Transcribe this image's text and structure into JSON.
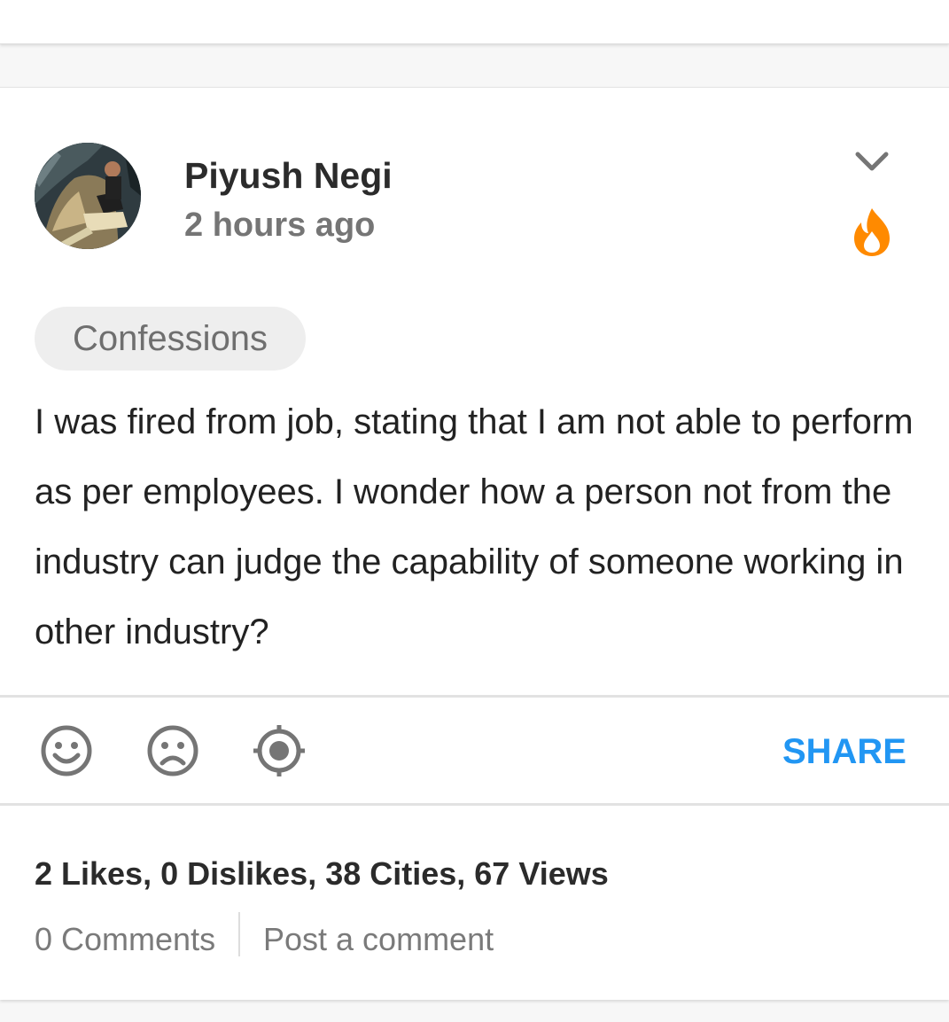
{
  "post": {
    "author": "Piyush Negi",
    "timestamp": "2 hours ago",
    "category": "Confessions",
    "text": "I was fired from job, stating that I am not able to perform as per employees. I wonder how a person not from the industry can judge the capability of someone working in other industry?"
  },
  "header_icons": {
    "menu": "chevron-down-icon",
    "trending": "fire-icon",
    "trending_color": "#ff8a00"
  },
  "actions": {
    "like_icon": "smiley-icon",
    "dislike_icon": "sad-face-icon",
    "location_icon": "crosshair-icon",
    "share_label": "SHARE",
    "accent_color": "#2196f3"
  },
  "stats": {
    "summary": "2 Likes, 0 Dislikes, 38 Cities, 67 Views"
  },
  "comments": {
    "count_label": "0 Comments",
    "post_label": "Post a comment"
  }
}
